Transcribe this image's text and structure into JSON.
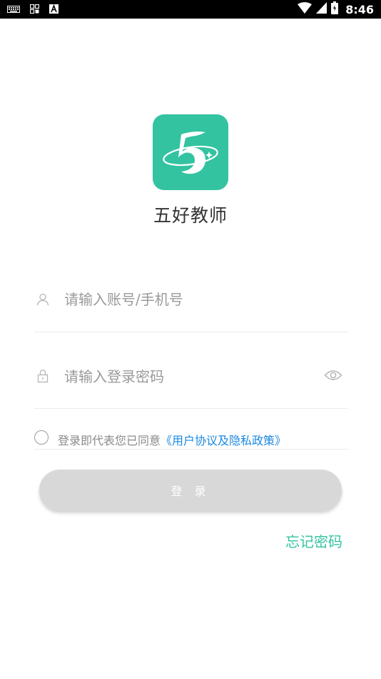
{
  "status_bar": {
    "time": "8:46",
    "icons": [
      "keyboard-icon",
      "grid-icon",
      "font-icon",
      "wifi-icon",
      "signal-icon",
      "battery-icon"
    ]
  },
  "app": {
    "name": "五好教师",
    "brand_color": "#34c3a1"
  },
  "login_form": {
    "account_placeholder": "请输入账号/手机号",
    "password_placeholder": "请输入登录密码",
    "account_value": "",
    "password_value": "",
    "agreement_text": "登录即代表您已同意",
    "agreement_link": "《用户协议及隐私政策》",
    "agreement_checked": false,
    "login_label": "登 录",
    "forgot_password_label": "忘记密码"
  },
  "colors": {
    "accent": "#34c3a1",
    "link": "#1a88e0",
    "button_disabled": "#d8d8d8",
    "placeholder": "#9a9a9a"
  }
}
